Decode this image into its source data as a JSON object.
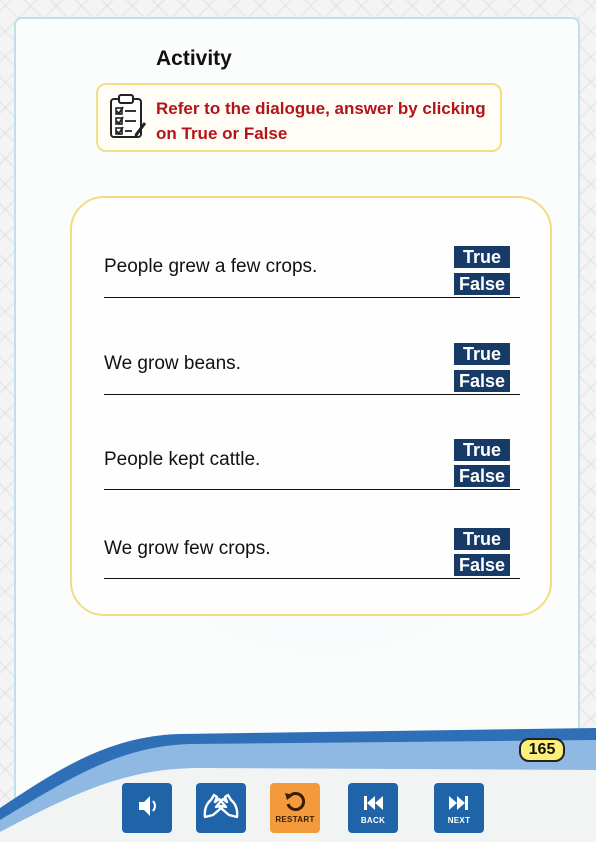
{
  "title": "Activity",
  "instruction": {
    "icon": "clipboard-checklist-icon",
    "text": "Refer to the dialogue, answer by clicking on True or False"
  },
  "questions": [
    {
      "text": "People grew a few crops.",
      "true_label": "True",
      "false_label": "False"
    },
    {
      "text": "We grow beans.",
      "true_label": "True",
      "false_label": "False"
    },
    {
      "text": "People kept cattle.",
      "true_label": "True",
      "false_label": "False"
    },
    {
      "text": "We grow few crops.",
      "true_label": "True",
      "false_label": "False"
    }
  ],
  "page_number": "165",
  "toolbar": {
    "audio_icon": "speaker-icon",
    "sign_icon": "sign-language-icon",
    "restart_label": "RESTART",
    "back_label": "BACK",
    "next_label": "NEXT"
  },
  "colors": {
    "button_bg": "#173b66",
    "instruction_text": "#b3131b",
    "toolbar_blue": "#1f63a8",
    "restart_orange": "#f39a3d",
    "box_border": "#f0dc83"
  }
}
